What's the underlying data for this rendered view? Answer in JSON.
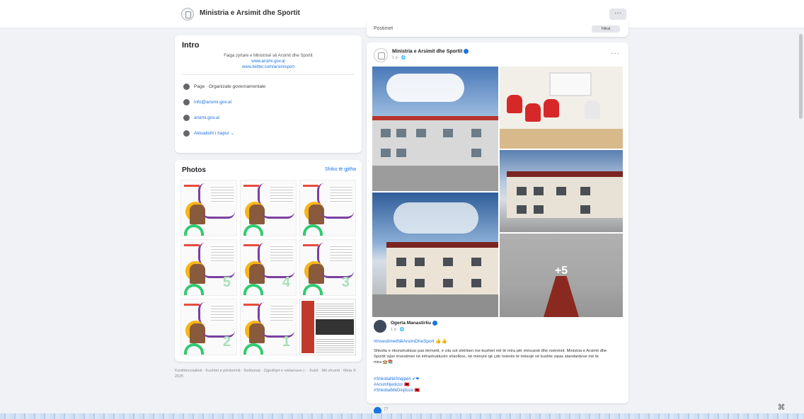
{
  "header": {
    "title": "Ministria e Arsimit dhe Sportit",
    "more_label": "···"
  },
  "intro": {
    "heading": "Intro",
    "bio": "Faqja zyrtare e Ministrisë së Arsimit dhe Sportit",
    "links": [
      "www.arsimi.gov.al",
      "www.twitter.com/arsimisport"
    ],
    "details": [
      {
        "icon": "info-icon",
        "label": "Page · Organizate governamentale"
      },
      {
        "icon": "email-icon",
        "label": "info@arsimi.gov.al"
      },
      {
        "icon": "web-icon",
        "label": "arsimi.gov.al"
      },
      {
        "icon": "clock-icon",
        "label": "Aktualisht i hapur ⌄"
      }
    ]
  },
  "photos": {
    "heading": "Photos",
    "see_all": "Shiko të gjitha",
    "tile_numbers": [
      "",
      "",
      "",
      "5",
      "4",
      "3",
      "2",
      "1",
      ""
    ]
  },
  "footer": {
    "text": "Konfidencialiteti · Kushtet e përdorimit · Reklamat · Zgjedhjet e reklamave ▷ · Kukit · Më shumë · Meta © 2025"
  },
  "tabbar": {
    "label": "Postimet",
    "button": "Filtrat"
  },
  "post": {
    "author": "Ministria e Arsimit dhe Sportit",
    "meta": "1 d · 🌐",
    "more_label": "···",
    "more_photos": "+5",
    "shared": {
      "author": "Ogerta Manastirliu",
      "meta": "1 d · 🌐",
      "hashtag": "#InvestimetNëArsimDheSport 👍👍",
      "body": "Shkolla e rikonstruktuar pas tërmetit, e cila sot shërben me kushtet më të mira për mësuesit dhe nxënësit. Ministria e Arsimit dhe Sportit vijon investimet në infrastrukturën shkollore, në mënyrë që çdo nxënës të mësojë në kushte sipas standardeve më të mira 🏫📚",
      "tags": [
        "#ShkollaNëShqipëri ✔❤",
        "#ArsimNjerëzor 🇦🇱",
        "#ShkollatMëDinjitoze 🇦🇱"
      ]
    },
    "reactions": "77"
  },
  "corner_button": "⌘",
  "colors": {
    "accent": "#1b74e4",
    "background": "#f0f2f5"
  }
}
